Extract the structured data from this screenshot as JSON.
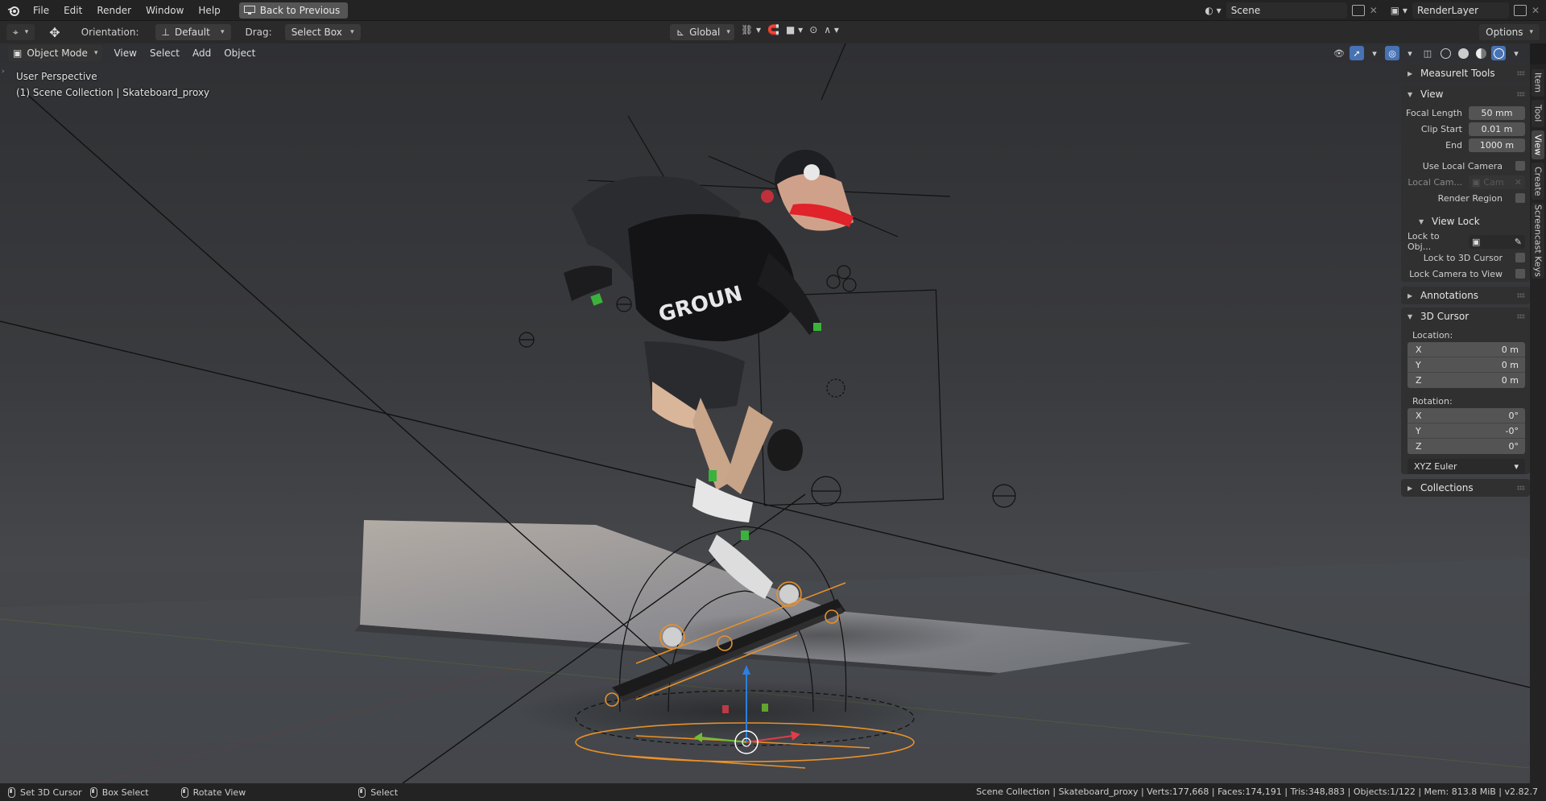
{
  "topbar": {
    "menus": [
      "File",
      "Edit",
      "Render",
      "Window",
      "Help"
    ],
    "back_button": "Back to Previous",
    "scene_name": "Scene",
    "render_layer": "RenderLayer"
  },
  "toolbar": {
    "orientation_label": "Orientation:",
    "orientation_value": "Default",
    "drag_label": "Drag:",
    "drag_value": "Select Box",
    "transform_orientation": "Global",
    "options_label": "Options"
  },
  "viewport": {
    "mode": "Object Mode",
    "menus": [
      "View",
      "Select",
      "Add",
      "Object"
    ],
    "perspective_text": "User Perspective",
    "collection_text": "(1) Scene Collection | Skateboard_proxy"
  },
  "npanel": {
    "measureit": "MeasureIt Tools",
    "view_section": "View",
    "focal_length_label": "Focal Length",
    "focal_length_value": "50 mm",
    "clip_start_label": "Clip Start",
    "clip_start_value": "0.01 m",
    "end_label": "End",
    "end_value": "1000 m",
    "use_local_camera": "Use Local Camera",
    "local_camera_label": "Local Cam...",
    "local_camera_value": "Cam",
    "render_region": "Render Region",
    "view_lock": "View Lock",
    "lock_to_object": "Lock to Obj...",
    "lock_to_3d_cursor": "Lock to 3D Cursor",
    "lock_camera_to_view": "Lock Camera to View",
    "annotations": "Annotations",
    "cursor_section": "3D Cursor",
    "location_label": "Location:",
    "location": [
      {
        "axis": "X",
        "value": "0 m"
      },
      {
        "axis": "Y",
        "value": "0 m"
      },
      {
        "axis": "Z",
        "value": "0 m"
      }
    ],
    "rotation_label": "Rotation:",
    "rotation": [
      {
        "axis": "X",
        "value": "0°"
      },
      {
        "axis": "Y",
        "value": "-0°"
      },
      {
        "axis": "Z",
        "value": "0°"
      }
    ],
    "rotation_mode": "XYZ Euler",
    "collections": "Collections"
  },
  "vtabs": [
    "Item",
    "Tool",
    "View",
    "Create",
    "Screencast Keys"
  ],
  "statusbar": {
    "set_cursor": "Set 3D Cursor",
    "box_select": "Box Select",
    "rotate_view": "Rotate View",
    "select": "Select",
    "stats": "Scene Collection | Skateboard_proxy | Verts:177,668 | Faces:174,191 | Tris:348,883 | Objects:1/122 | Mem: 813.8 MiB | v2.82.7"
  },
  "colors": {
    "accent": "#4772b3",
    "selection_orange": "#e8912a"
  }
}
